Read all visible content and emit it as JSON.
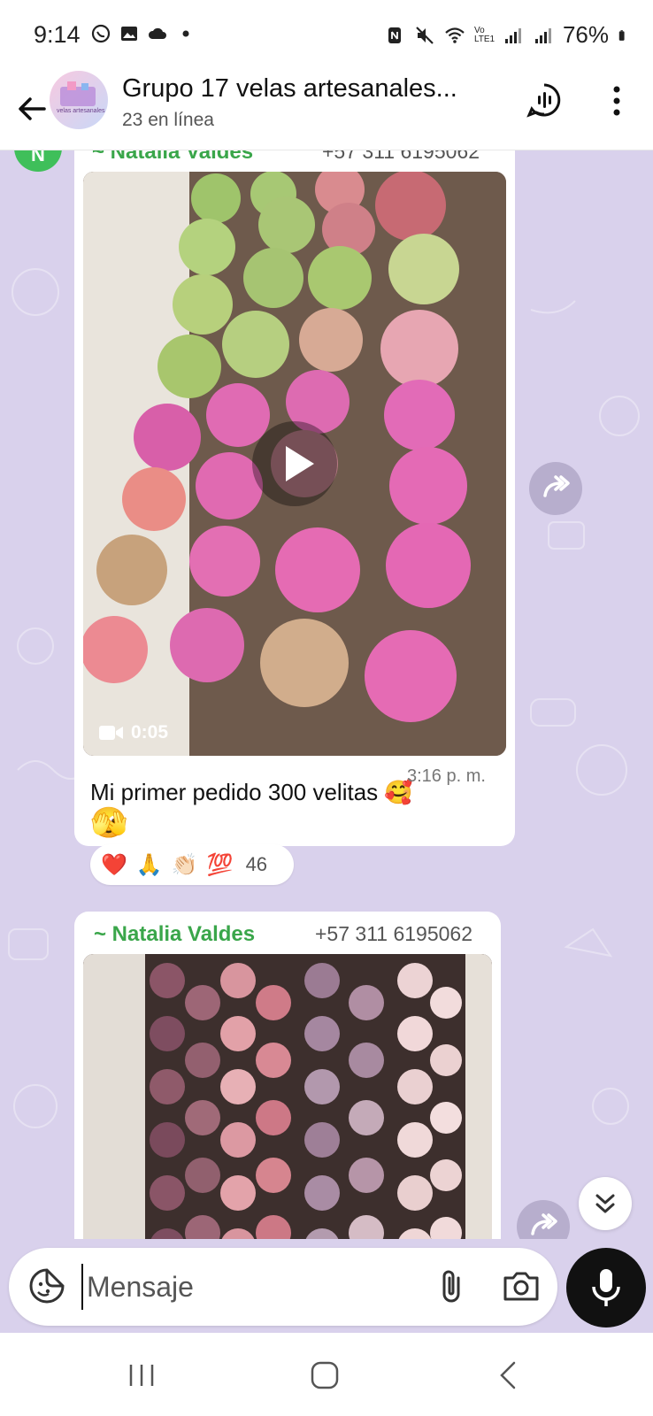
{
  "status_bar": {
    "time": "9:14",
    "battery": "76%",
    "network_label": "Vo LTE1",
    "icons": [
      "whatsapp-status-icon",
      "gallery-icon",
      "cloud-icon",
      "dot-icon",
      "nfc-icon",
      "mute-icon",
      "wifi-icon",
      "signal-icon",
      "signal-icon-2",
      "battery-icon"
    ]
  },
  "header": {
    "title": "Grupo 17 velas artesanales...",
    "subtitle": "23 en línea",
    "avatar_text": "velas artesanales",
    "back_icon": "arrow-left-icon",
    "voice_chat_icon": "voice-chat-icon",
    "more_icon": "more-vertical-icon"
  },
  "messages": [
    {
      "sender_initial": "N",
      "sender_name": "~ Natalia Valdes",
      "sender_phone": "+57 311 6195062",
      "media_type": "video",
      "duration": "0:05",
      "caption": "Mi primer pedido 300 velitas 🥰",
      "extra_emoji": "🫣",
      "time": "3:16 p. m.",
      "reactions": {
        "emojis": [
          "❤️",
          "🙏",
          "👏🏻",
          "💯"
        ],
        "count": "46"
      }
    },
    {
      "sender_name": "~ Natalia Valdes",
      "sender_phone": "+57 311 6195062",
      "media_type": "image"
    }
  ],
  "composer": {
    "placeholder": "Mensaje",
    "sticker_icon": "sticker-icon",
    "attach_icon": "paperclip-icon",
    "camera_icon": "camera-icon",
    "mic_icon": "microphone-icon"
  },
  "colors": {
    "chat_background": "#d9d1ec",
    "sender_name": "#3aa64a",
    "avatar_green": "#3fbf5a"
  }
}
